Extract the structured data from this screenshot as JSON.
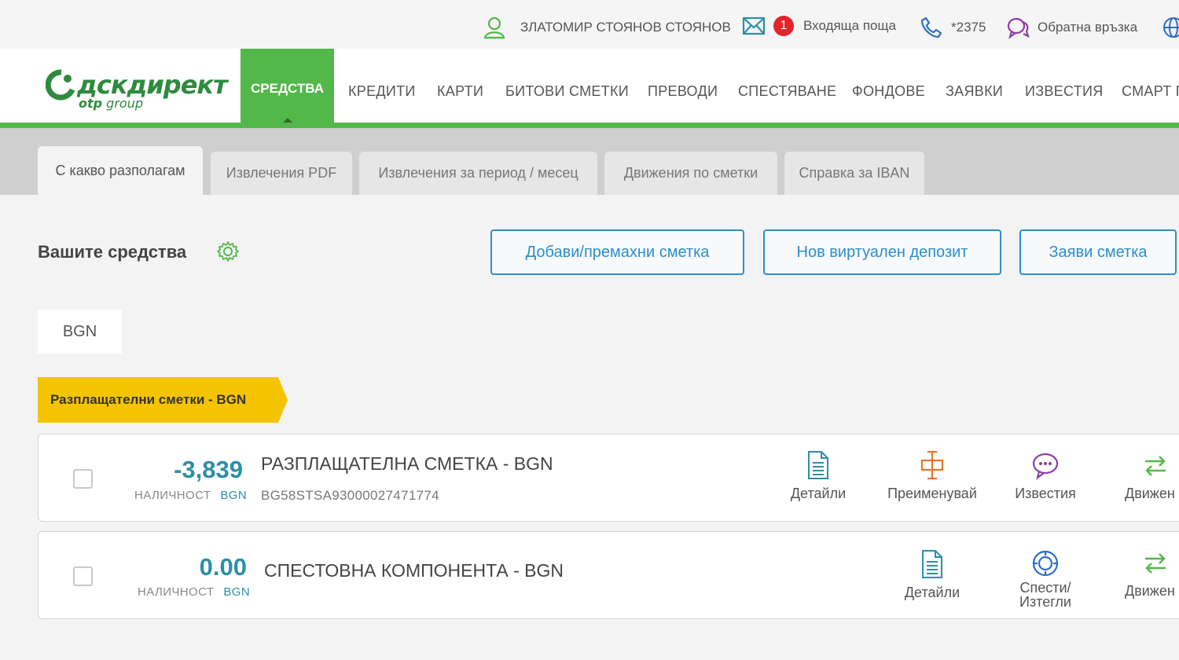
{
  "topbar": {
    "user_name": "ЗЛАТОМИР СТОЯНОВ СТОЯНОВ",
    "inbox_count": "1",
    "inbox_label": "Входяща поща",
    "phone": "*2375",
    "feedback_label": "Обратна връзка"
  },
  "logo": {
    "main": "дскдирект",
    "sub_bold": "otp",
    "sub_rest": " group"
  },
  "nav": {
    "active": "СРЕДСТВА",
    "items": [
      "КРЕДИТИ",
      "КАРТИ",
      "БИТОВИ СМЕТКИ",
      "ПРЕВОДИ",
      "СПЕСТЯВАНЕ",
      "ФОНДОВЕ",
      "ЗАЯВКИ",
      "ИЗВЕСТИЯ",
      "СМАРТ П"
    ]
  },
  "tabs": [
    "С какво разполагам",
    "Извлечения PDF",
    "Извлечения за период / месец",
    "Движения по сметки",
    "Справка за IBAN"
  ],
  "section": {
    "title": "Вашите средства",
    "buttons": [
      "Добави/премахни сметка",
      "Нов виртуален депозит",
      "Заяви сметка"
    ],
    "currency_tab": "BGN",
    "group_label": "Разплащателни сметки - BGN"
  },
  "accounts": [
    {
      "amount": "-3,839",
      "balance_label": "НАЛИЧНОСТ",
      "currency": "BGN",
      "name": "РАЗПЛАЩАТЕЛНА СМЕТКА - BGN",
      "iban": "BG58STSA93000027471774",
      "actions": [
        "Детайли",
        "Преименувай",
        "Известия",
        "Движен"
      ]
    },
    {
      "amount": "0.00",
      "balance_label": "НАЛИЧНОСТ",
      "currency": "BGN",
      "name": "СПЕСТОВНА КОМПОНЕНТА - BGN",
      "actions": [
        "Детайли",
        "Спести/",
        "Изтегли",
        "Движен"
      ]
    }
  ],
  "colors": {
    "brand_green": "#53b84a",
    "accent_blue": "#2c8fc7",
    "ribbon_yellow": "#f5c400",
    "badge_red": "#e3242b"
  }
}
